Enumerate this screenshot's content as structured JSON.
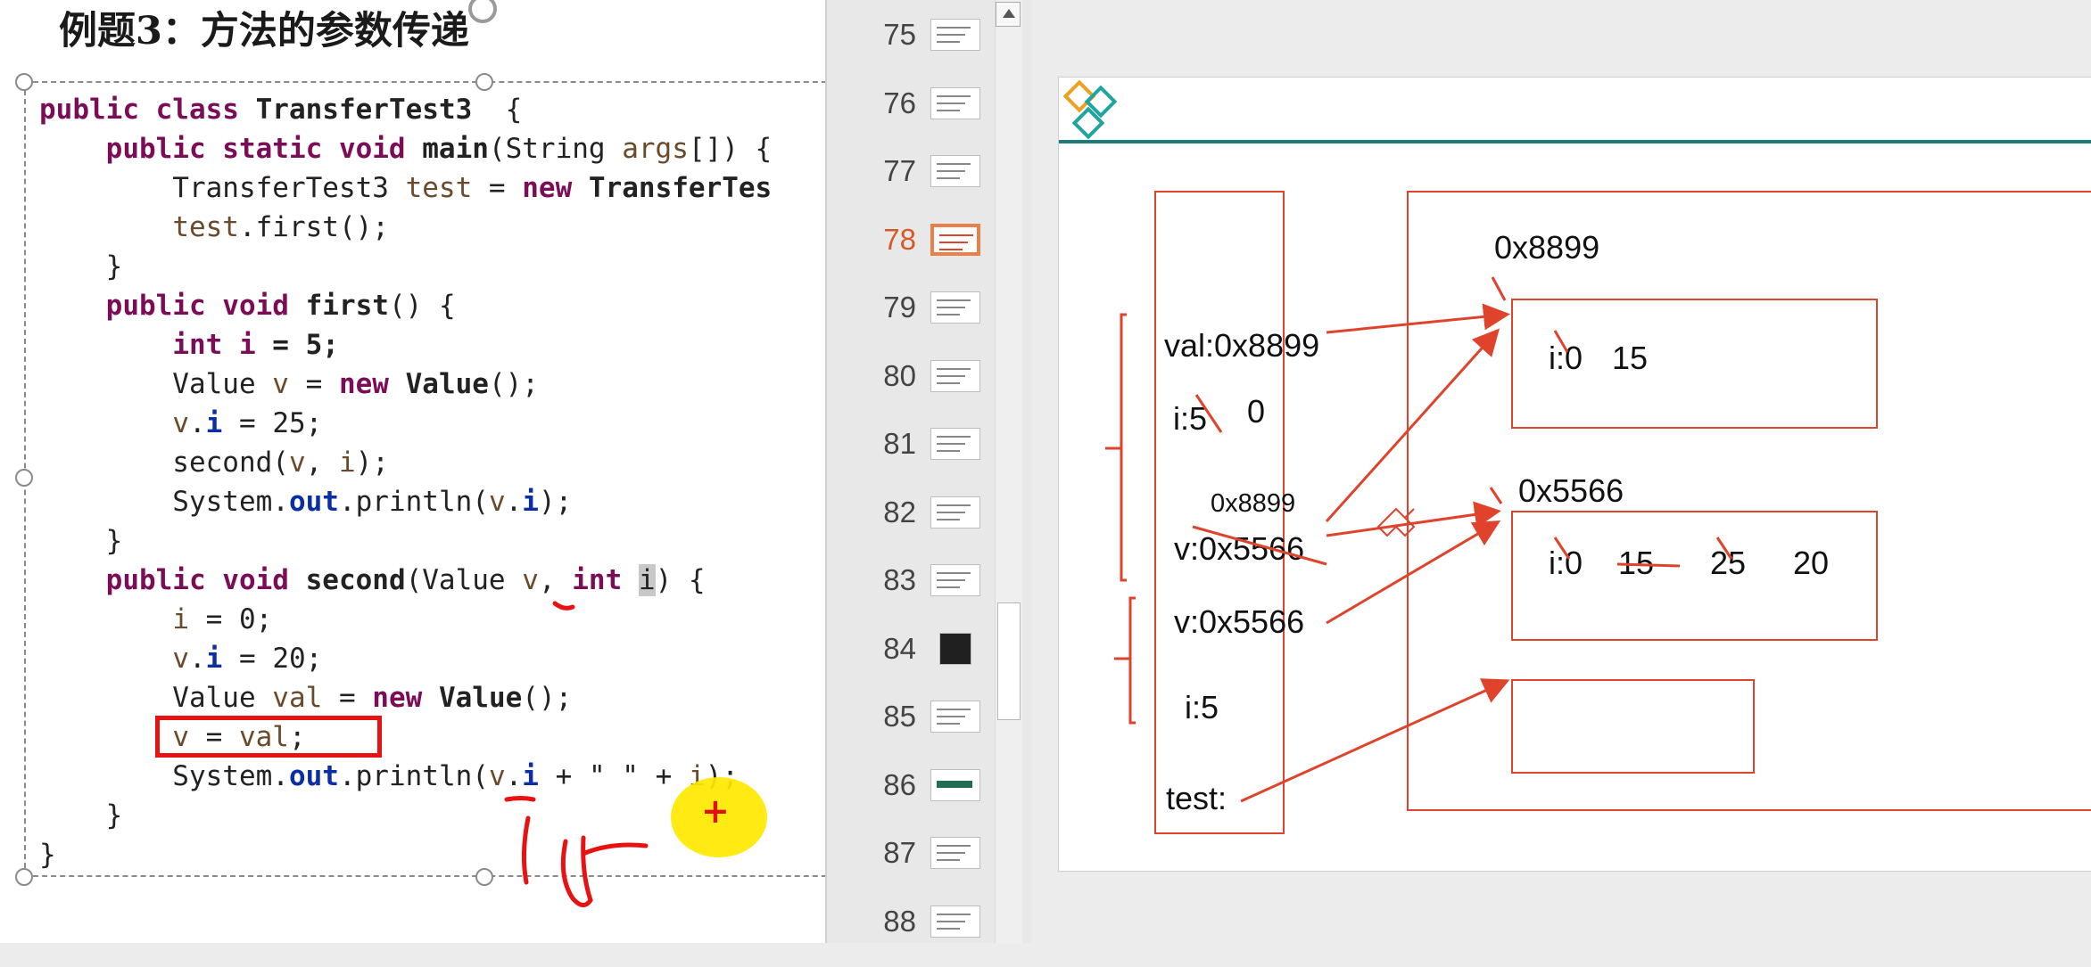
{
  "slide_title": "例题3：方法的参数传递",
  "code_lines": [
    [
      [
        "kw",
        "public class "
      ],
      [
        "cls",
        "TransferTest3"
      ],
      [
        "",
        "  {"
      ]
    ],
    [
      [
        "",
        "    "
      ],
      [
        "kw",
        "public static void "
      ],
      [
        "cls",
        "main"
      ],
      [
        "",
        "(String "
      ],
      [
        "var",
        "args"
      ],
      [
        "",
        "[]) {"
      ]
    ],
    [
      [
        "",
        "        TransferTest3 "
      ],
      [
        "var",
        "test"
      ],
      [
        "",
        " = "
      ],
      [
        "kw",
        "new "
      ],
      [
        "cls",
        "TransferTes"
      ]
    ],
    [
      [
        "",
        "        "
      ],
      [
        "var",
        "test"
      ],
      [
        "",
        ".first();"
      ]
    ],
    [
      [
        "",
        "    }"
      ]
    ],
    [
      [
        "",
        "    "
      ],
      [
        "kw",
        "public void "
      ],
      [
        "cls",
        "first"
      ],
      [
        "",
        "() {"
      ]
    ],
    [
      [
        "",
        "        "
      ],
      [
        "kw",
        "int i"
      ],
      [
        "cls",
        " = 5;"
      ]
    ],
    [
      [
        "",
        "        Value "
      ],
      [
        "var",
        "v"
      ],
      [
        "",
        " = "
      ],
      [
        "kw",
        "new "
      ],
      [
        "cls",
        "Value"
      ],
      [
        "",
        "();"
      ]
    ],
    [
      [
        "",
        "        "
      ],
      [
        "var",
        "v"
      ],
      [
        "",
        "."
      ],
      [
        "fld",
        "i"
      ],
      [
        "",
        " = 25;"
      ]
    ],
    [
      [
        "",
        "        second("
      ],
      [
        "var",
        "v"
      ],
      [
        "",
        ", "
      ],
      [
        "var",
        "i"
      ],
      [
        "",
        ");"
      ]
    ],
    [
      [
        "",
        "        System."
      ],
      [
        "fld",
        "out"
      ],
      [
        "",
        ".println("
      ],
      [
        "var",
        "v"
      ],
      [
        "",
        "."
      ],
      [
        "fld",
        "i"
      ],
      [
        "",
        ");"
      ]
    ],
    [
      [
        "",
        "    }"
      ]
    ],
    [
      [
        "",
        "    "
      ],
      [
        "kw",
        "public void "
      ],
      [
        "cls",
        "second"
      ],
      [
        "",
        "(Value "
      ],
      [
        "var",
        "v"
      ],
      [
        "",
        ", "
      ],
      [
        "kw",
        "int "
      ],
      [
        "seli",
        "i"
      ],
      [
        "",
        ") {"
      ]
    ],
    [
      [
        "",
        "        "
      ],
      [
        "var",
        "i"
      ],
      [
        "",
        " = 0;"
      ]
    ],
    [
      [
        "",
        "        "
      ],
      [
        "var",
        "v"
      ],
      [
        "",
        "."
      ],
      [
        "fld",
        "i"
      ],
      [
        "",
        " = 20;"
      ]
    ],
    [
      [
        "",
        "        Value "
      ],
      [
        "var",
        "val"
      ],
      [
        "",
        " = "
      ],
      [
        "kw",
        "new "
      ],
      [
        "cls",
        "Value"
      ],
      [
        "",
        "();"
      ]
    ],
    [
      [
        "",
        "        "
      ],
      [
        "var",
        "v"
      ],
      [
        "",
        " = "
      ],
      [
        "var",
        "val"
      ],
      [
        "",
        ";"
      ]
    ],
    [
      [
        "",
        "        System."
      ],
      [
        "fld",
        "out"
      ],
      [
        "",
        ".println("
      ],
      [
        "var",
        "v"
      ],
      [
        "",
        "."
      ],
      [
        "fld",
        "i"
      ],
      [
        "",
        " + \" \" + "
      ],
      [
        "var",
        "i"
      ],
      [
        "",
        ");"
      ]
    ],
    [
      [
        "",
        "    }"
      ]
    ],
    [
      [
        "",
        "}"
      ]
    ]
  ],
  "thumbnails": [
    {
      "num": "75"
    },
    {
      "num": "76"
    },
    {
      "num": "77"
    },
    {
      "num": "78",
      "active": true
    },
    {
      "num": "79"
    },
    {
      "num": "80"
    },
    {
      "num": "81"
    },
    {
      "num": "82"
    },
    {
      "num": "83"
    },
    {
      "num": "84",
      "dark": true
    },
    {
      "num": "85"
    },
    {
      "num": "86",
      "green": true
    },
    {
      "num": "87"
    },
    {
      "num": "88"
    }
  ],
  "diagram": {
    "heap_addr_top": "0x8899",
    "heap_addr_mid": "0x5566",
    "obj1_i": "i:0",
    "obj1_val": "15",
    "obj2_i": "i:0",
    "obj2_v1": "15",
    "obj2_v2": "25",
    "obj2_v3": "20",
    "stack_val": "val:0x8899",
    "stack_i_first": "i:5",
    "stack_i_first_new": "0",
    "stack_v_overwrite": "0x8899",
    "stack_v_second": "v:0x5566",
    "stack_v_first": "v:0x5566",
    "stack_i_main": "i:5",
    "stack_test": "test:"
  },
  "colors": {
    "accent_red": "#e0432c",
    "header_teal": "#1a7b77",
    "active_thumb": "#d65a25",
    "logo_orange": "#f0a020"
  }
}
